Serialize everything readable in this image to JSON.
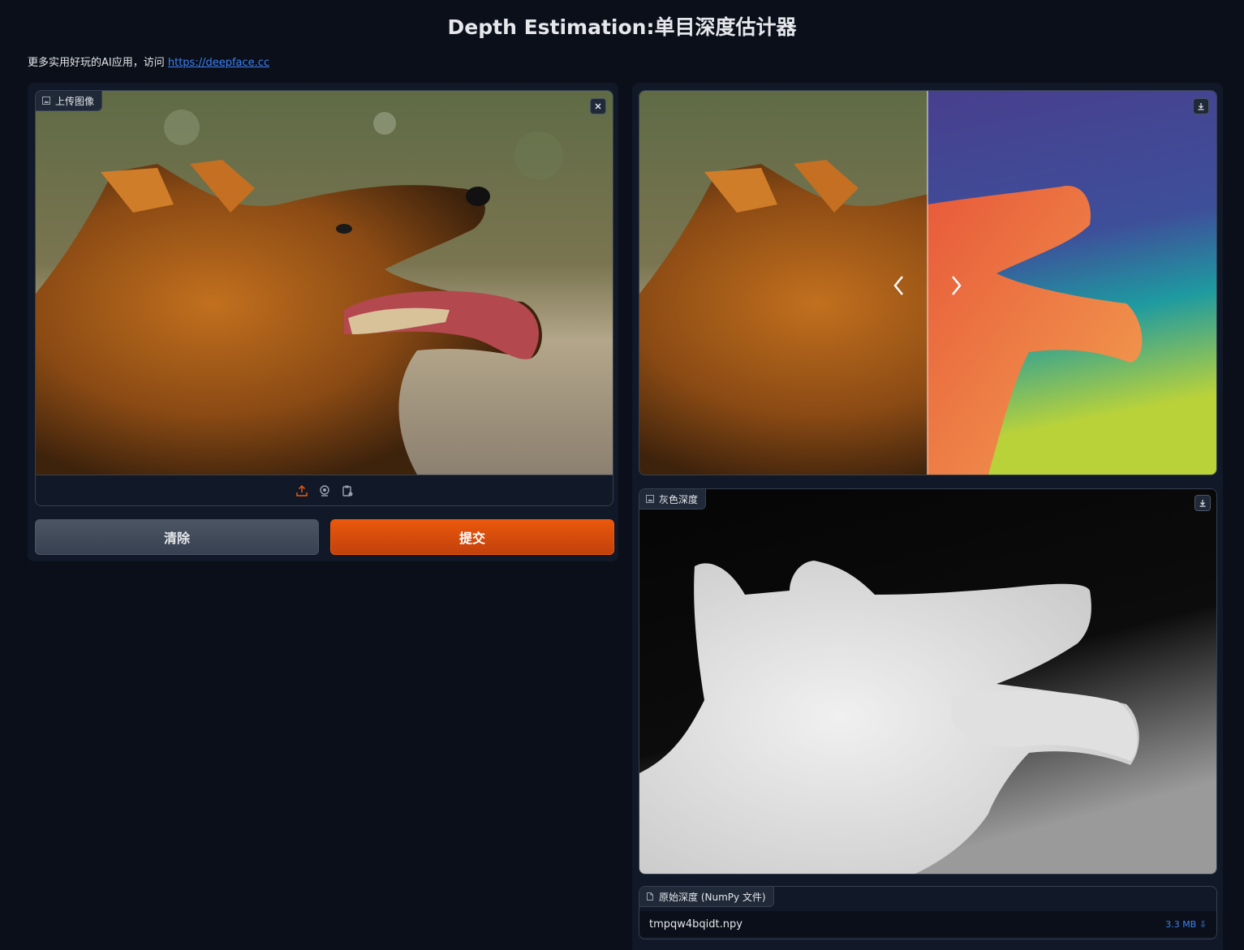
{
  "app": {
    "title": "Depth Estimation:单目深度估计器",
    "intro_text": "更多实用好玩的AI应用，访问 ",
    "intro_link": "https://deepface.cc"
  },
  "input_panel": {
    "label": "上传图像",
    "label_icon": "image-icon",
    "close_icon": "close-icon",
    "toolbar_icons": [
      "upload-icon",
      "webcam-icon",
      "clipboard-icon"
    ]
  },
  "actions": {
    "clear_label": "清除",
    "submit_label": "提交"
  },
  "slider_panel": {
    "download_icon": "download-icon",
    "prev_icon": "chevron-left-icon",
    "next_icon": "chevron-right-icon"
  },
  "gray_panel": {
    "label": "灰色深度",
    "label_icon": "image-icon",
    "download_icon": "download-icon"
  },
  "file_panel": {
    "label": "原始深度 (NumPy 文件)",
    "label_icon": "file-icon",
    "file_name": "tmpqw4bqidt.npy",
    "file_size": "3.3 MB ⇩"
  },
  "colors": {
    "background": "#0b0f19",
    "panel": "#111827",
    "border": "#374151",
    "accent": "#ea580c",
    "link": "#3b82f6"
  }
}
